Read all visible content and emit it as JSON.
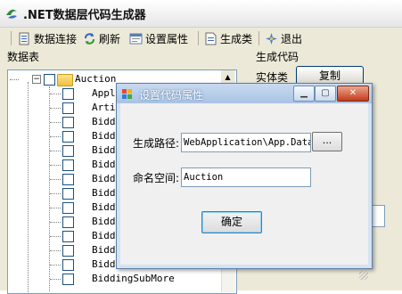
{
  "window": {
    "title": ".NET数据层代码生成器"
  },
  "toolbar": {
    "items": [
      {
        "label": "数据连接",
        "icon": "database-connect-icon"
      },
      {
        "label": "刷新",
        "icon": "refresh-icon"
      },
      {
        "label": "设置属性",
        "icon": "properties-icon"
      },
      {
        "label": "生成类",
        "icon": "generate-class-icon"
      },
      {
        "label": "退出",
        "icon": "exit-icon"
      }
    ]
  },
  "left_panel": {
    "heading": "数据表",
    "tree": {
      "root": "Auction",
      "children": [
        "Appl",
        "Arti",
        "Biddi",
        "Biddi",
        "Biddi",
        "Biddi",
        "Biddi",
        "Biddi",
        "Biddi",
        "Biddi",
        "Biddi",
        "Biddi",
        "Biddi",
        "BiddingSubMore"
      ]
    }
  },
  "right_panel": {
    "heading": "生成代码",
    "entity_label": "实体类",
    "copy_button": "复制"
  },
  "dialog": {
    "title": "设置代码属性",
    "path_label": "生成路径:",
    "path_value": "WebApplication\\App.Data",
    "browse_button": "...",
    "namespace_label": "命名空间:",
    "namespace_value": "Auction",
    "ok_button": "确定"
  }
}
